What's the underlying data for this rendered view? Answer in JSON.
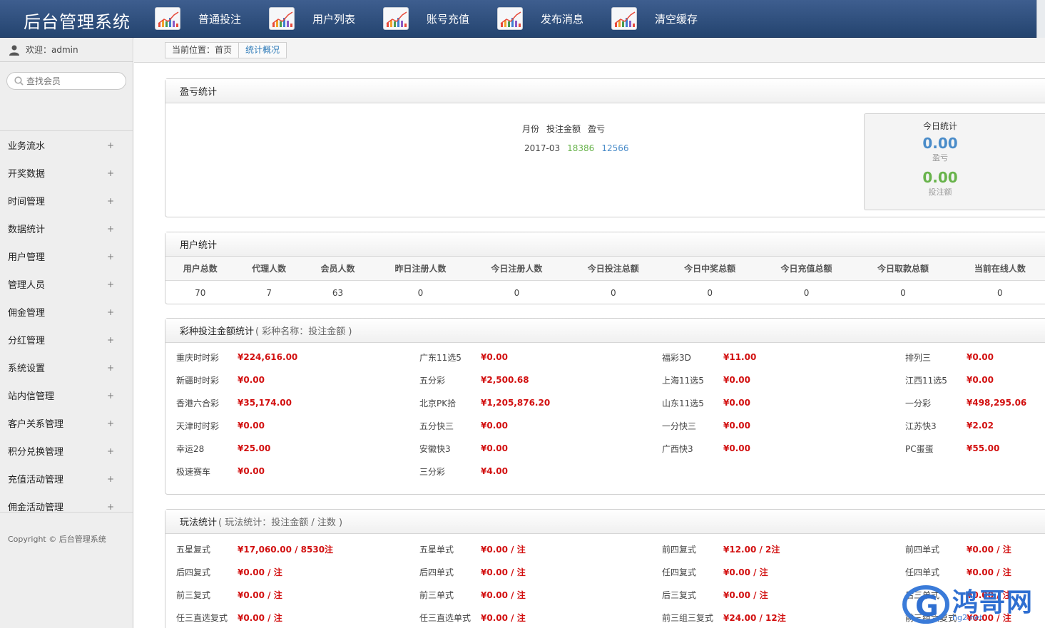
{
  "app": {
    "title": "后台管理系统"
  },
  "nav": [
    {
      "label": "普通投注"
    },
    {
      "label": "用户列表"
    },
    {
      "label": "账号充值"
    },
    {
      "label": "发布消息"
    },
    {
      "label": "清空缓存"
    }
  ],
  "sidebar": {
    "welcome": "欢迎：admin",
    "search_placeholder": "查找会员",
    "items": [
      {
        "label": "业务流水"
      },
      {
        "label": "开奖数据"
      },
      {
        "label": "时间管理"
      },
      {
        "label": "数据统计"
      },
      {
        "label": "用户管理"
      },
      {
        "label": "管理人员"
      },
      {
        "label": "佣金管理"
      },
      {
        "label": "分红管理"
      },
      {
        "label": "系统设置"
      },
      {
        "label": "站内信管理"
      },
      {
        "label": "客户关系管理"
      },
      {
        "label": "积分兑换管理"
      },
      {
        "label": "充值活动管理"
      },
      {
        "label": "佣金活动管理"
      }
    ],
    "expand_symbol": "+",
    "copyright": "Copyright © 后台管理系统"
  },
  "breadcrumb": {
    "prefix": "当前位置：首页",
    "current": "统计概况"
  },
  "profit": {
    "title": "盈亏统计",
    "headers": [
      "月份",
      "投注金额",
      "盈亏"
    ],
    "rows": [
      {
        "month": "2017-03",
        "bet": "18386",
        "profit": "12566"
      }
    ],
    "today": {
      "title": "今日统计",
      "profit_value": "0.00",
      "profit_label": "盈亏",
      "bet_value": "0.00",
      "bet_label": "投注额"
    }
  },
  "users": {
    "title": "用户统计",
    "headers": [
      "用户总数",
      "代理人数",
      "会员人数",
      "昨日注册人数",
      "今日注册人数",
      "今日投注总额",
      "今日中奖总额",
      "今日充值总额",
      "今日取款总额",
      "当前在线人数"
    ],
    "values": [
      "70",
      "7",
      "63",
      "0",
      "0",
      "0",
      "0",
      "0",
      "0",
      "0"
    ]
  },
  "lottery": {
    "title": "彩种投注金额统计",
    "subtitle": "( 彩种名称：投注金额 )",
    "columns": [
      [
        {
          "name": "重庆时时彩",
          "value": "¥224,616.00"
        },
        {
          "name": "新疆时时彩",
          "value": "¥0.00"
        },
        {
          "name": "香港六合彩",
          "value": "¥35,174.00"
        },
        {
          "name": "天津时时彩",
          "value": "¥0.00"
        },
        {
          "name": "幸运28",
          "value": "¥25.00"
        },
        {
          "name": "极速赛车",
          "value": "¥0.00"
        }
      ],
      [
        {
          "name": "广东11选5",
          "value": "¥0.00"
        },
        {
          "name": "五分彩",
          "value": "¥2,500.68"
        },
        {
          "name": "北京PK拾",
          "value": "¥1,205,876.20"
        },
        {
          "name": "五分快三",
          "value": "¥0.00"
        },
        {
          "name": "安徽快3",
          "value": "¥0.00"
        },
        {
          "name": "三分彩",
          "value": "¥4.00"
        }
      ],
      [
        {
          "name": "福彩3D",
          "value": "¥11.00"
        },
        {
          "name": "上海11选5",
          "value": "¥0.00"
        },
        {
          "name": "山东11选5",
          "value": "¥0.00"
        },
        {
          "name": "一分快三",
          "value": "¥0.00"
        },
        {
          "name": "广西快3",
          "value": "¥0.00"
        }
      ],
      [
        {
          "name": "排列三",
          "value": "¥0.00"
        },
        {
          "name": "江西11选5",
          "value": "¥0.00"
        },
        {
          "name": "一分彩",
          "value": "¥498,295.06"
        },
        {
          "name": "江苏快3",
          "value": "¥2.02"
        },
        {
          "name": "PC蛋蛋",
          "value": "¥55.00"
        }
      ]
    ]
  },
  "plays": {
    "title": "玩法统计",
    "subtitle": "( 玩法统计：投注金额 / 注数 )",
    "columns": [
      [
        {
          "name": "五星复式",
          "value": "¥17,060.00 / 8530注"
        },
        {
          "name": "后四复式",
          "value": "¥0.00 / 注"
        },
        {
          "name": "前三复式",
          "value": "¥0.00 / 注"
        },
        {
          "name": "任三直选复式",
          "value": "¥0.00 / 注"
        }
      ],
      [
        {
          "name": "五星单式",
          "value": "¥0.00 / 注"
        },
        {
          "name": "后四单式",
          "value": "¥0.00 / 注"
        },
        {
          "name": "前三单式",
          "value": "¥0.00 / 注"
        },
        {
          "name": "任三直选单式",
          "value": "¥0.00 / 注"
        }
      ],
      [
        {
          "name": "前四复式",
          "value": "¥12.00 / 2注"
        },
        {
          "name": "任四复式",
          "value": "¥0.00 / 注"
        },
        {
          "name": "后三复式",
          "value": "¥0.00 / 注"
        },
        {
          "name": "前三组三复式",
          "value": "¥24.00 / 12注"
        }
      ],
      [
        {
          "name": "前四单式",
          "value": "¥0.00 / 注"
        },
        {
          "name": "任四单式",
          "value": "¥0.00 / 注"
        },
        {
          "name": "后三单式",
          "value": "¥0.00 / 注"
        },
        {
          "name": "前三组六复式",
          "value": "¥0.00 / 注"
        }
      ]
    ]
  },
  "watermark": {
    "brand": "鸿哥网",
    "url": "hg2.net"
  },
  "colors": {
    "header": "#2e4f7e",
    "accent_red": "#d21010",
    "accent_green": "#68b34b",
    "accent_blue": "#4a8cc9"
  }
}
